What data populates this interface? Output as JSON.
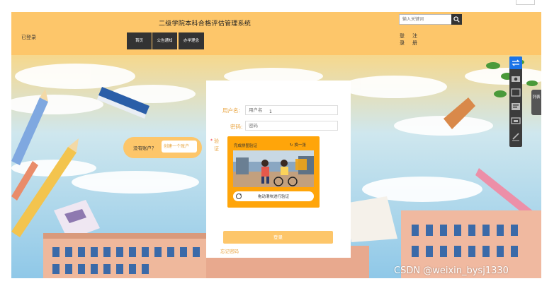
{
  "header": {
    "site_title": "二级学院本科合格评估管理系统",
    "brand": "已登录",
    "search_placeholder": "输入关键词",
    "nav": [
      "首页",
      "公告通知",
      "办学理念"
    ],
    "login_label": "登录",
    "register_label": "注册"
  },
  "side_panel": {
    "no_account_label": "没有账户？",
    "create_account_label": "创建一个账户"
  },
  "login_form": {
    "username_label": "用户名:",
    "username_placeholder": "用户名",
    "cursor_text": "1",
    "password_label": "密码:",
    "password_placeholder": "密码",
    "captcha_label": "验证",
    "captcha_required_mark": "*",
    "captcha_title": "完成拼图验证",
    "captcha_refresh_label": "换一张",
    "slider_text": "拖动滑块进行验证",
    "login_button_label": "登录",
    "forgot_password_label": "忘记密码"
  },
  "toolbar": {
    "icons": [
      "switch-icon",
      "camera-icon",
      "window-icon",
      "text-extract-icon",
      "screenshot-icon",
      "pen-icon"
    ],
    "list_tab_label": "列表"
  },
  "watermark": "CSDN @weixin_bysj1330",
  "colors": {
    "header_bg": "#fdc66a",
    "accent": "#e9a440",
    "captcha_bg": "#ffa50a",
    "nav_bg": "#333333",
    "toolbar_active": "#1a73e8"
  }
}
